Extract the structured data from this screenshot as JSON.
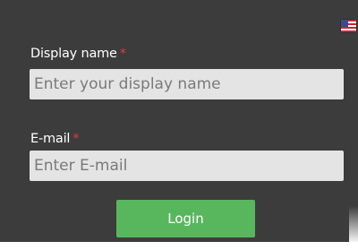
{
  "form": {
    "display_name": {
      "label": "Display name",
      "required_mark": "*",
      "placeholder": "Enter your display name",
      "value": ""
    },
    "email": {
      "label": "E-mail",
      "required_mark": "*",
      "placeholder": "Enter E-mail",
      "value": ""
    },
    "login_label": "Login"
  },
  "language": {
    "icon": "us-flag-icon"
  },
  "colors": {
    "panel_background": "#3c3c3c",
    "field_background": "#e4e4e4",
    "required_mark": "#e5393b",
    "login_button": "#58b75c",
    "text": "#ffffff"
  }
}
